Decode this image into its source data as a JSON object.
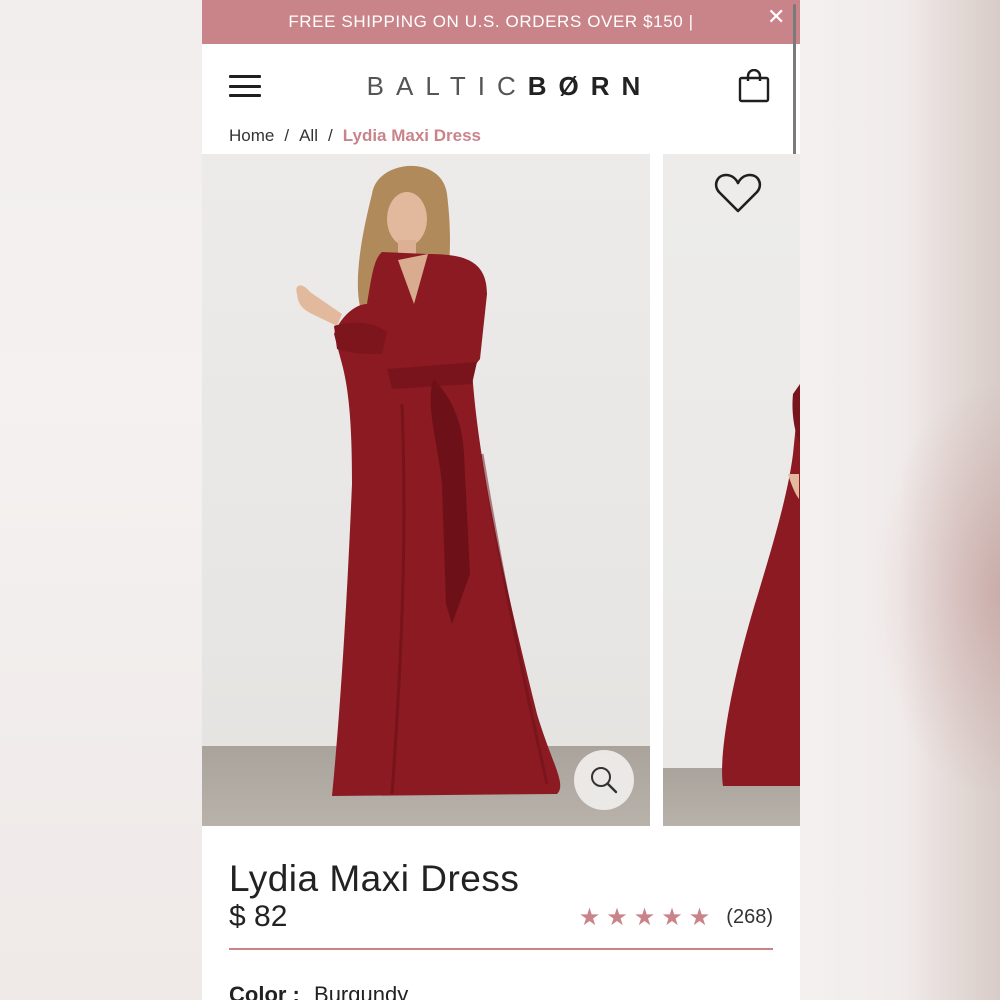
{
  "promo": {
    "text": "FREE SHIPPING ON U.S. ORDERS OVER $150 |",
    "close_icon": "close-icon"
  },
  "header": {
    "menu_icon": "hamburger-icon",
    "logo_part1": "BALTIC",
    "logo_part2": "BØRN",
    "cart_icon": "shopping-bag-icon"
  },
  "breadcrumb": [
    "Home",
    "All",
    "Lydia Maxi Dress"
  ],
  "gallery": {
    "wishlist_icon": "heart-icon",
    "zoom_icon": "magnifier-icon"
  },
  "product": {
    "title": "Lydia Maxi Dress",
    "price": "$ 82",
    "rating_stars": 5,
    "review_count": "(268)",
    "color_label": "Color :",
    "color_value": "Burgundy"
  },
  "colors": {
    "accent": "#c9848a",
    "dress": "#8b1a22"
  }
}
